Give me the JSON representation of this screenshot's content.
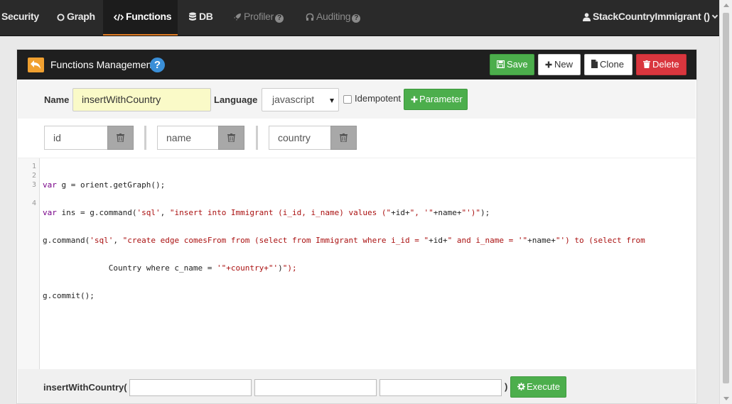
{
  "nav": {
    "security": "Security",
    "graph": "Graph",
    "functions": "Functions",
    "db": "DB",
    "profiler": "Profiler",
    "auditing": "Auditing",
    "user": "StackCountryImmigrant ()",
    "help_glyph": "?"
  },
  "panel": {
    "title": "Functions Management",
    "help_glyph": "?",
    "buttons": {
      "save": "Save",
      "new": "New",
      "clone": "Clone",
      "delete": "Delete"
    }
  },
  "form": {
    "name_label": "Name",
    "name_value": "insertWithCountry",
    "language_label": "Language",
    "language_value": "javascript",
    "idempotent_label": "Idempotent",
    "idempotent_checked": false,
    "parameter_button": "Parameter"
  },
  "parameters": [
    "id",
    "name",
    "country"
  ],
  "editor": {
    "line_numbers": [
      "1",
      "2",
      "3",
      "4"
    ],
    "lines": [
      "var g = orient.getGraph();",
      "var ins = g.command('sql', \"insert into Immigrant (i_id, i_name) values (\"+id+\", '\"+name+\"')\");",
      "g.command('sql', \"create edge comesFrom from (select from Immigrant where i_id = \"+id+\" and i_name = '\"+name+\"') to (select from",
      "              Country where c_name = '\"+country+\"')\");",
      "g.commit();"
    ]
  },
  "footer": {
    "function_call": "insertWithCountry(",
    "close_paren": ")",
    "execute_button": "Execute",
    "args": [
      "",
      "",
      ""
    ]
  },
  "colors": {
    "navbar_bg": "#2a2a2a",
    "active_underline": "#e07b24",
    "success": "#4cae4c",
    "danger": "#d9363e",
    "name_highlight": "#fafac8",
    "help_blue": "#3a8fd8"
  }
}
